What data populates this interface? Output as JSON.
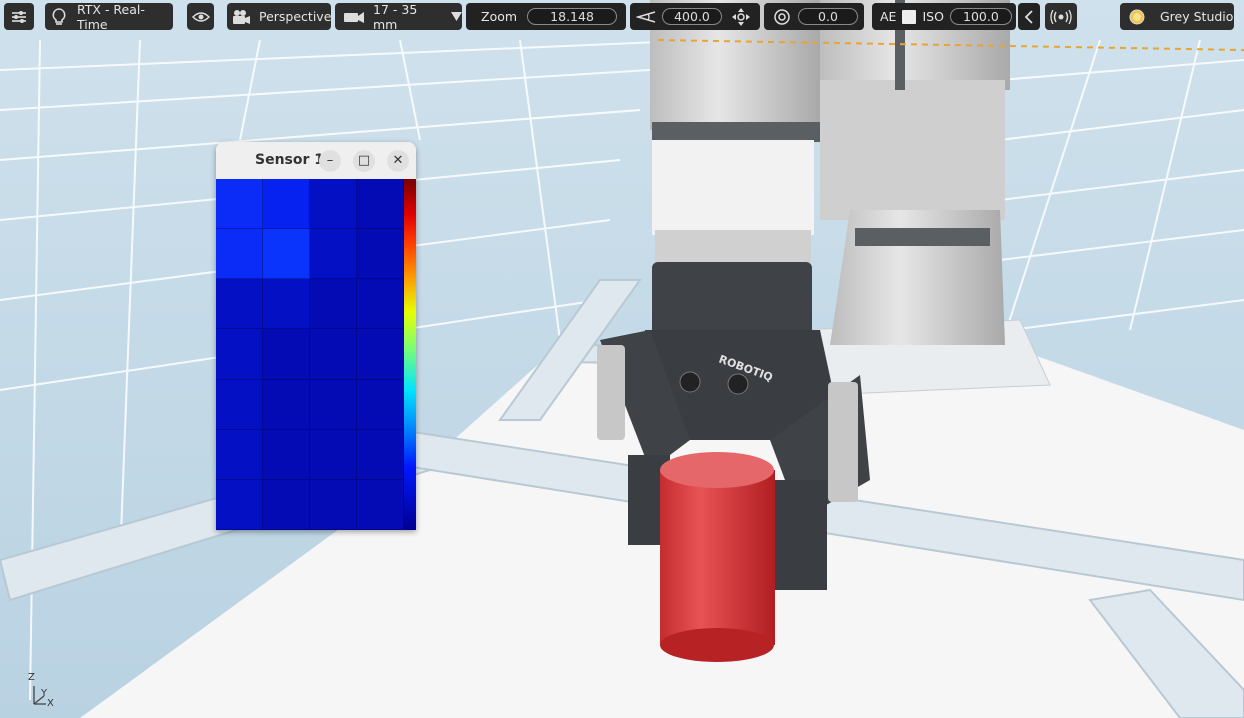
{
  "toolbar": {
    "render_mode": "RTX - Real-Time",
    "camera": "Perspective",
    "lens": "17 - 35 mm",
    "zoom_label": "Zoom",
    "zoom_value": "18.148",
    "fov_value": "400.0",
    "exposure_value": "0.0",
    "ae_label": "AE",
    "iso_label": "ISO",
    "iso_value": "100.0",
    "lighting": "Grey Studio"
  },
  "sensor_window": {
    "title": "Sensor 1",
    "minimize": "–",
    "maximize": "□",
    "close": "✕",
    "grid": {
      "rows": 7,
      "cols": 4,
      "cells": [
        [
          "#0a2cf6",
          "#0622f0",
          "#0410c4",
          "#040bb4"
        ],
        [
          "#0a2cf6",
          "#0a34fb",
          "#0410c4",
          "#040bb4"
        ],
        [
          "#0410c4",
          "#0410c4",
          "#040bb4",
          "#040bb4"
        ],
        [
          "#0410c4",
          "#040bb4",
          "#040bb4",
          "#040bb4"
        ],
        [
          "#0410c4",
          "#040bb4",
          "#040bb4",
          "#040bb4"
        ],
        [
          "#0410c4",
          "#040bb4",
          "#040bb4",
          "#040bb4"
        ],
        [
          "#0410c4",
          "#040bb4",
          "#040bb4",
          "#040bb4"
        ]
      ]
    }
  },
  "gripper": {
    "brand": "ROBOTIQ"
  },
  "axis_gizmo": {
    "z": "Z",
    "y": "Y",
    "x": "X"
  }
}
